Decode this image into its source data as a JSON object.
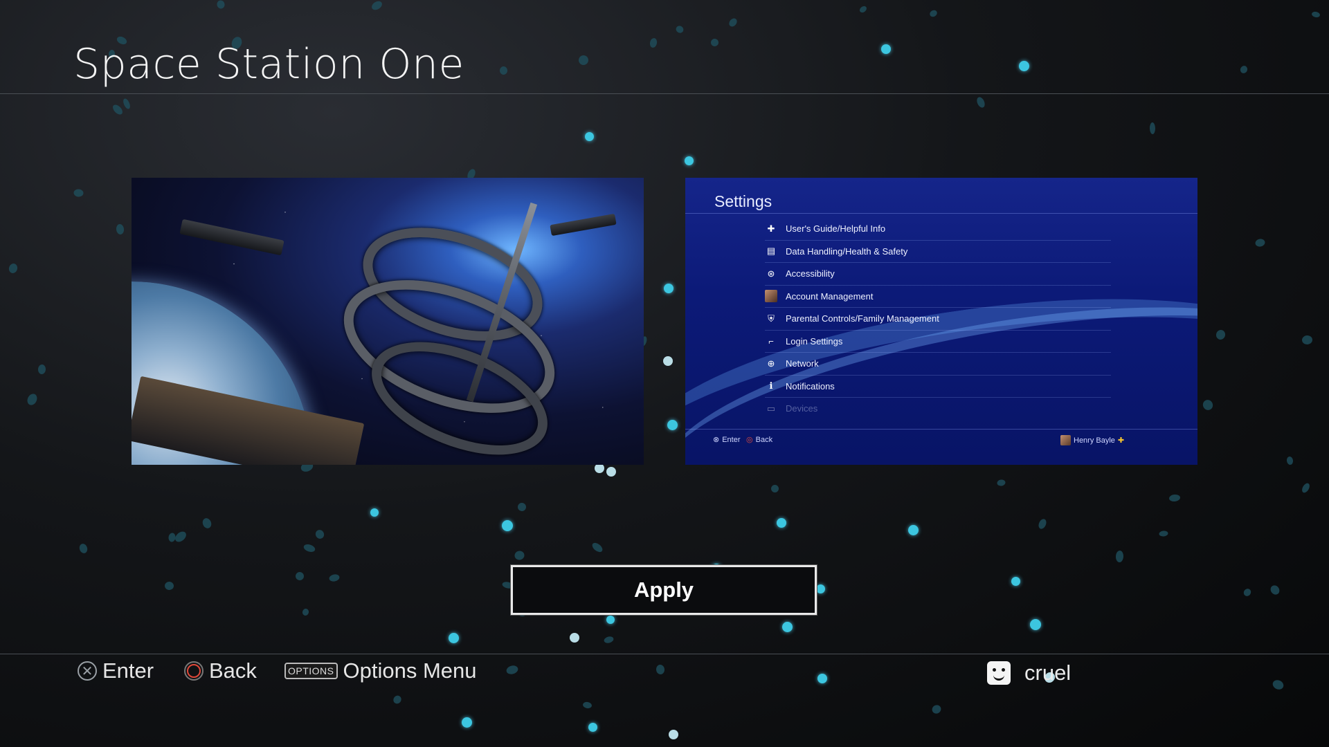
{
  "page": {
    "title": "Space Station One"
  },
  "preview_settings": {
    "title": "Settings",
    "items": [
      {
        "icon": "guide-icon",
        "label": "User's Guide/Helpful Info"
      },
      {
        "icon": "data-handling-icon",
        "label": "Data Handling/Health & Safety"
      },
      {
        "icon": "accessibility-icon",
        "label": "Accessibility"
      },
      {
        "icon": "account-icon",
        "label": "Account Management"
      },
      {
        "icon": "parental-controls-icon",
        "label": "Parental Controls/Family Management"
      },
      {
        "icon": "login-icon",
        "label": "Login Settings"
      },
      {
        "icon": "network-icon",
        "label": "Network"
      },
      {
        "icon": "notifications-icon",
        "label": "Notifications"
      },
      {
        "icon": "devices-icon",
        "label": "Devices"
      }
    ],
    "footer": {
      "enter": "Enter",
      "back": "Back",
      "user": "Henry Bayle"
    }
  },
  "apply_label": "Apply",
  "hints": {
    "enter": "Enter",
    "back": "Back",
    "options_chip": "OPTIONS",
    "options": "Options Menu"
  },
  "user": {
    "name": "cruel"
  },
  "colors": {
    "particle": "#3cc6e0",
    "background": "#141619",
    "settings_blue": "#0c1a78"
  }
}
